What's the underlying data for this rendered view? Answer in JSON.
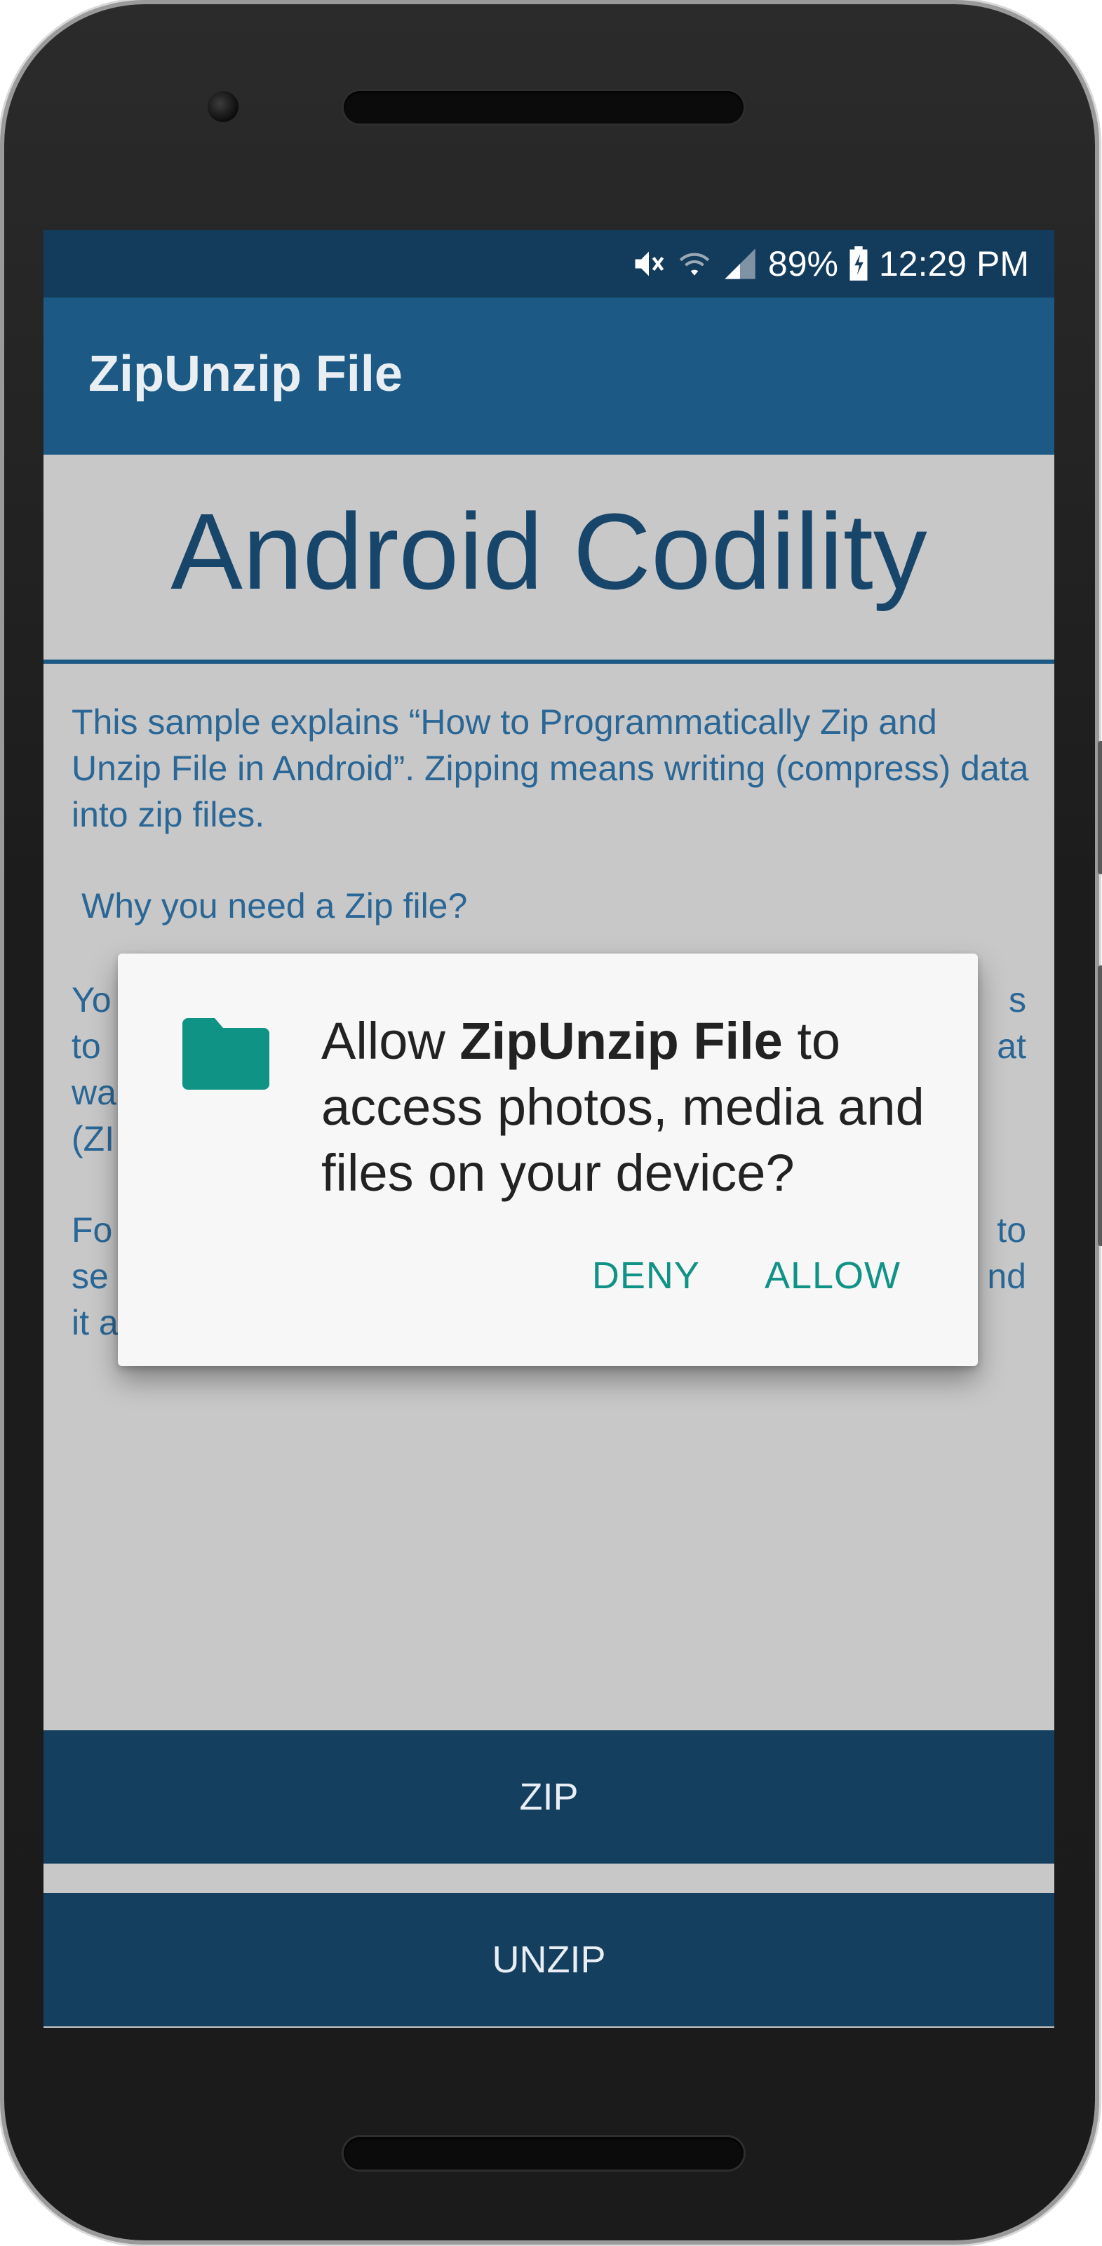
{
  "status_bar": {
    "battery": "89%",
    "time": "12:29 PM",
    "icons": [
      "mute-icon",
      "wifi-icon",
      "signal-icon",
      "battery-charging-icon"
    ]
  },
  "app_bar": {
    "title": "ZipUnzip File"
  },
  "content": {
    "title": "Android Codility",
    "paragraph_1": "This sample explains “How to Programmatically Zip and Unzip File in Android”. Zipping means writing (compress) data into zip files.",
    "question": "Why you need a Zip file?",
    "paragraph_2_visible": [
      "Yo",
      "to",
      "wa",
      "(ZI"
    ],
    "paragraph_2_right": [
      "s",
      "at"
    ],
    "paragraph_3_visible": [
      "Fo",
      "se",
      "it a"
    ],
    "paragraph_3_right": [
      "to",
      "nd"
    ]
  },
  "dialog": {
    "message_prefix": "Allow ",
    "app_name": "ZipUnzip File",
    "message_suffix": " to access photos, media and files on your device?",
    "deny_label": "DENY",
    "allow_label": "ALLOW",
    "icon": "folder-icon"
  },
  "buttons": {
    "zip_label": "ZIP",
    "unzip_label": "UNZIP"
  },
  "colors": {
    "status_bar": "#133c5c",
    "app_bar": "#1c5a85",
    "background": "#c8c8c8",
    "accent": "#109386",
    "button": "#153f5f"
  }
}
